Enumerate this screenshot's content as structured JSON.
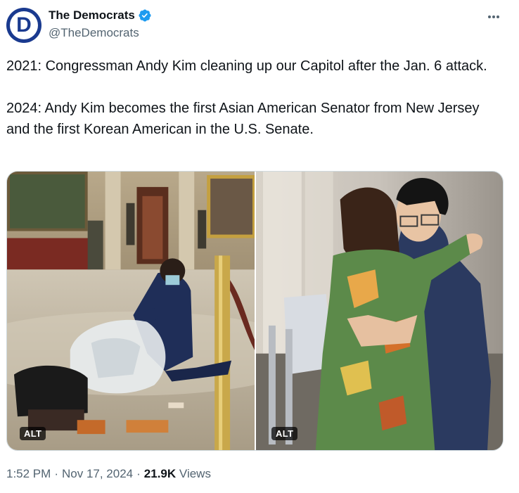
{
  "account": {
    "display_name": "The Democrats",
    "handle": "@TheDemocrats",
    "avatar_letter": "D",
    "brand_color": "#1a3a8f",
    "verified_color": "#1d9bf0"
  },
  "tweet": {
    "paragraphs": [
      "2021: Congressman Andy Kim cleaning up our Capitol after the Jan. 6 attack.",
      "2024: Andy Kim becomes the first Asian American Senator from New Jersey and the first Korean American in the U.S. Senate."
    ],
    "media": [
      {
        "alt_badge": "ALT"
      },
      {
        "alt_badge": "ALT"
      }
    ],
    "time": "1:52 PM",
    "separator": "·",
    "date": "Nov 17, 2024",
    "views_count": "21.9K",
    "views_label": "Views"
  },
  "icons": {
    "more": "more-horizontal-icon",
    "verified": "verified-badge-icon"
  }
}
